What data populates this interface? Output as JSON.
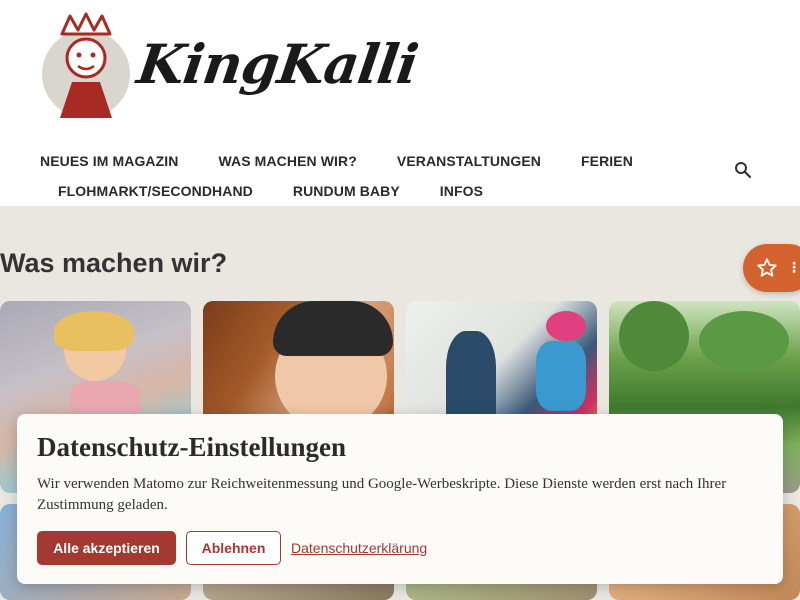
{
  "brand": {
    "name": "KingKalli",
    "colors": {
      "logo_red": "#a82a22",
      "accent": "#a33a32",
      "fab": "#d4622e"
    }
  },
  "nav": {
    "row1": [
      "NEUES IM MAGAZIN",
      "WAS MACHEN WIR?",
      "VERANSTALTUNGEN",
      "FERIEN"
    ],
    "row2": [
      "FLOHMARKT/SECONDHAND",
      "RUNDUM BABY",
      "INFOS"
    ],
    "search_icon": "search-icon"
  },
  "favorites": {
    "star_icon": "star-outline-icon",
    "more": "⋮"
  },
  "section": {
    "title": "Was machen wir?"
  },
  "cards": [
    "child-chalk-drawing",
    "child-riding-helmet",
    "children-costumes",
    "park-playground",
    "card-5",
    "card-6",
    "card-7",
    "card-8"
  ],
  "consent": {
    "title": "Datenschutz-Einstellungen",
    "text": "Wir verwenden Matomo zur Reichweitenmessung und Google-Werbeskripte. Diese Dienste werden erst nach Ihrer Zustimmung geladen.",
    "accept": "Alle akzeptieren",
    "reject": "Ablehnen",
    "privacy_link": "Datenschutzerklärung"
  }
}
